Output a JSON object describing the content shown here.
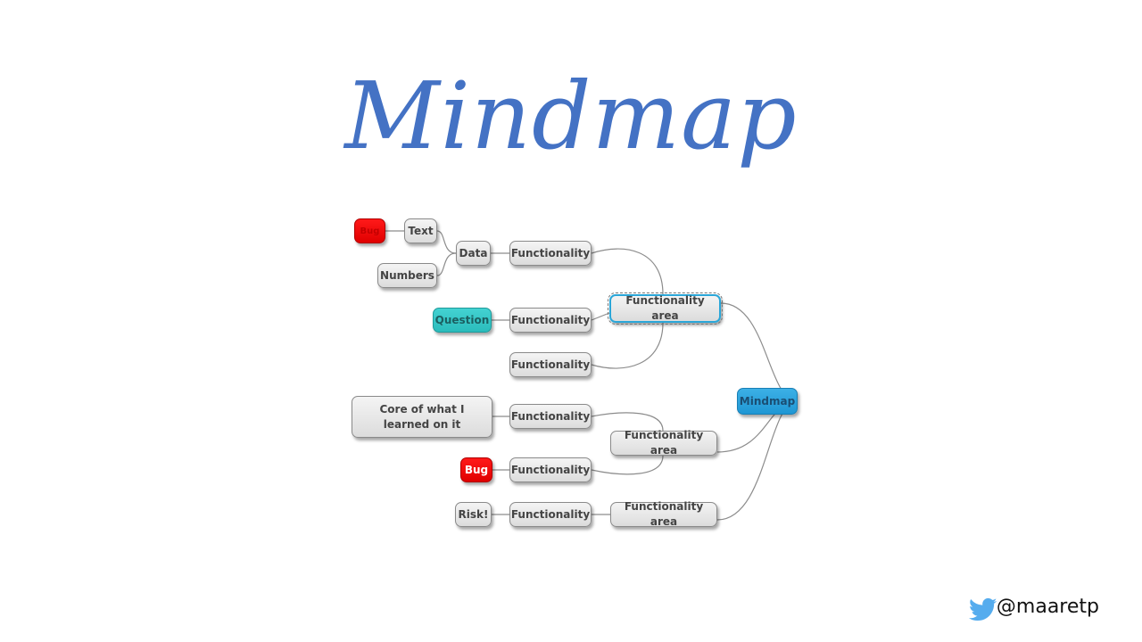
{
  "title": "Mindmap",
  "mindmap": {
    "root": "Mindmap",
    "nodes": {
      "bug_top": "Bug",
      "text": "Text",
      "data": "Data",
      "numbers": "Numbers",
      "func_1": "Functionality",
      "area_1": "Functionality area",
      "question": "Question",
      "func_2": "Functionality",
      "func_3": "Functionality",
      "core": "Core of what I learned on it",
      "func_4": "Functionality",
      "area_2": "Functionality area",
      "bug_mid": "Bug",
      "func_5": "Functionality",
      "risk": "Risk!",
      "func_6": "Functionality",
      "area_3": "Functionality area"
    },
    "colors": {
      "root": "#1f97d4",
      "bug": "#e00000",
      "question": "#2bbcbc",
      "default": "#dcdcdc"
    }
  },
  "footer": {
    "twitter_icon": "twitter-bird-icon",
    "handle": "@maaretp",
    "icon_color": "#55acee"
  }
}
